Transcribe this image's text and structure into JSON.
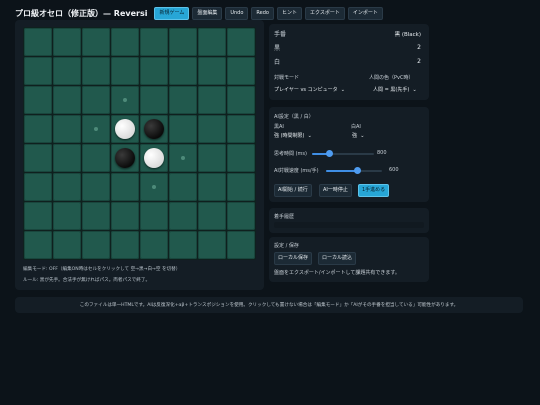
{
  "title": "プロ級オセロ（修正版）— Reversi",
  "toolbar": [
    {
      "label": "新規ゲーム",
      "active": true
    },
    {
      "label": "盤面編集",
      "active": false
    },
    {
      "label": "Undo",
      "active": false
    },
    {
      "label": "Redo",
      "active": false
    },
    {
      "label": "ヒント",
      "active": false
    },
    {
      "label": "エクスポート",
      "active": false
    },
    {
      "label": "インポート",
      "active": false
    }
  ],
  "board": {
    "rows": [
      "........",
      "........",
      "...h....",
      "..hWB...",
      "...BWh..",
      "....h...",
      "........",
      "........"
    ]
  },
  "notes": {
    "edit_mode": "編集モード: OFF（編集ON時はセルをクリックして 空→黒→白→空 を切替）",
    "rules": "ルール: 黒が先手。合法手が無ければパス。両者パスで終了。"
  },
  "status": {
    "turn_label": "手番",
    "turn_value": "黒 (Black)",
    "black_label": "黒",
    "black_count": "2",
    "white_label": "白",
    "white_count": "2",
    "mode_label": "対戦モード",
    "mode_value": "プレイヤー vs コンピュータ",
    "human_color_label": "人間の色（PvC時）",
    "human_color_value": "人間 = 黒(先手)"
  },
  "ai": {
    "section_label": "AI設定（黒 / 白）",
    "black_ai_label": "黒AI",
    "black_ai_value": "強 (時間制限)",
    "white_ai_label": "白AI",
    "white_ai_value": "強",
    "think_label": "思考時間 (ms)",
    "think_value": "800",
    "think_fraction": 0.28,
    "speed_label": "AI対戦速度 (ms/手)",
    "speed_value": "600",
    "speed_fraction": 0.55,
    "start_button": "AI開始 / 続行",
    "pause_button": "AI一時停止",
    "step_button": "1手進める"
  },
  "history": {
    "label": "着手履歴"
  },
  "save": {
    "label": "設定 / 保存",
    "local_save": "ローカル保存",
    "local_load": "ローカル読込",
    "note": "盤面をエクスポート/インポートして課題共有できます。"
  },
  "footer": "このファイルは単一HTMLです。AIは反復深化+αβ+トランスポジションを使用。クリックしても置けない場合は「編集モード」か「AIがその手番を担当している」可能性があります。",
  "colors": {
    "accent": "#27a6d6",
    "board_cell": "#21594d",
    "background": "#0c1319",
    "panel": "#141d25"
  }
}
